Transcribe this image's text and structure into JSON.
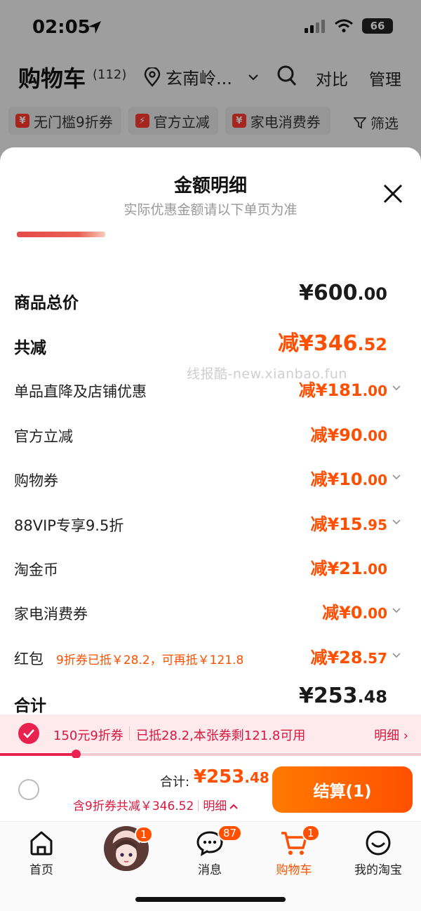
{
  "status_bar": {
    "time": "02:05",
    "battery": "66"
  },
  "header": {
    "title": "购物车",
    "count": "(112)",
    "location": "玄南岭...",
    "compare_label": "对比",
    "manage_label": "管理"
  },
  "chips": [
    {
      "icon": "¥",
      "label": "无门槛9折券"
    },
    {
      "icon": "⚡",
      "label": "官方立减"
    },
    {
      "icon": "¥",
      "label": "家电消费券"
    }
  ],
  "filter_label": "筛选",
  "sheet": {
    "title": "金额明细",
    "subtitle": "实际优惠金额请以下单页为准",
    "watermark": "线报酷-new.xianbao.fun",
    "rows": [
      {
        "label": "商品总价",
        "amount_main": "¥600",
        "amount_dec": ".00",
        "style": "total",
        "arrow": false
      },
      {
        "label": "共减",
        "amount_main": "减¥346",
        "amount_dec": ".52",
        "style": "discount-total",
        "arrow": false
      },
      {
        "label": "单品直降及店铺优惠",
        "amount_main": "减¥181",
        "amount_dec": ".00",
        "style": "item",
        "arrow": true
      },
      {
        "label": "官方立减",
        "amount_main": "减¥90",
        "amount_dec": ".00",
        "style": "item",
        "arrow": false
      },
      {
        "label": "购物券",
        "amount_main": "减¥10",
        "amount_dec": ".00",
        "style": "item",
        "arrow": true
      },
      {
        "label": "88VIP专享9.5折",
        "amount_main": "减¥15",
        "amount_dec": ".95",
        "style": "item",
        "arrow": true
      },
      {
        "label": "淘金币",
        "amount_main": "减¥21",
        "amount_dec": ".00",
        "style": "item",
        "arrow": false
      },
      {
        "label": "家电消费券",
        "amount_main": "减¥0",
        "amount_dec": ".00",
        "style": "item",
        "arrow": true
      },
      {
        "label": "红包",
        "note": "9折券已抵￥28.2，可再抵￥121.8",
        "amount_main": "减¥28",
        "amount_dec": ".57",
        "style": "item",
        "arrow": true
      },
      {
        "label": "合计",
        "amount_main": "¥253",
        "amount_dec": ".48",
        "style": "total",
        "arrow": false
      }
    ]
  },
  "coupon_bar": {
    "name": "150元9折券",
    "description": "已抵28.2,本张券剩121.8可用",
    "link": "明细",
    "progress": 0.18
  },
  "checkout": {
    "total_label": "合计:",
    "total_main": "¥253",
    "total_dec": ".48",
    "savings_text": "含9折券共减￥346.52",
    "detail_label": "明细",
    "pay_label": "结算(1)"
  },
  "tabbar": {
    "tabs": [
      {
        "label": "首页",
        "icon": "home-icon",
        "badge": ""
      },
      {
        "label": "",
        "icon": "avatar",
        "badge": "1"
      },
      {
        "label": "消息",
        "icon": "message-icon",
        "badge": "87"
      },
      {
        "label": "购物车",
        "icon": "cart-icon",
        "badge": "1",
        "active": true
      },
      {
        "label": "我的淘宝",
        "icon": "profile-icon",
        "badge": ""
      }
    ]
  },
  "colors": {
    "accent": "#ff5000",
    "coupon_red": "#d9173f",
    "badge": "#ff5000"
  }
}
